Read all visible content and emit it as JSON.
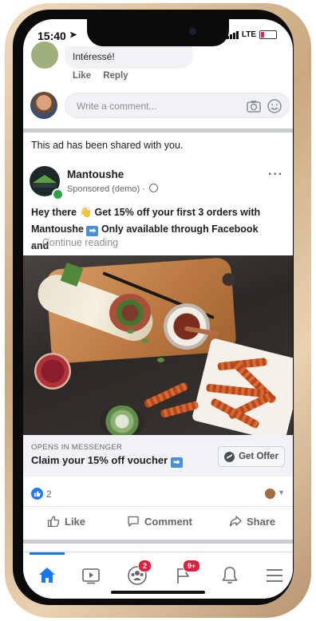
{
  "status_bar": {
    "time": "15:40",
    "network": "LTE"
  },
  "previous_comment": {
    "text": "Intéressé!",
    "like_label": "Like",
    "reply_label": "Reply"
  },
  "comment_composer": {
    "placeholder": "Write a comment..."
  },
  "shared_note": "This ad has been shared with you.",
  "post": {
    "page_name": "Mantoushe",
    "sponsored_label": "Sponsored (demo) ·",
    "text_line1": "Hey there 👋 Get 15% off your first 3 orders with",
    "text_line2_name": "Mantoushe",
    "text_line2_rest": "Only available through Facebook and",
    "continue_reading": "... Continue reading"
  },
  "cta": {
    "opens_in": "OPENS IN MESSENGER",
    "title": "Claim your 15% off voucher",
    "button_label": "Get Offer"
  },
  "reactions": {
    "count": "2"
  },
  "actions": {
    "like": "Like",
    "comment": "Comment",
    "share": "Share"
  },
  "tabbar": {
    "groups_badge": "2",
    "pages_badge": "9+",
    "active_tab": "home"
  },
  "colors": {
    "brand_blue": "#1877f2",
    "badge_red": "#e41e3f",
    "online_green": "#31a24c"
  }
}
